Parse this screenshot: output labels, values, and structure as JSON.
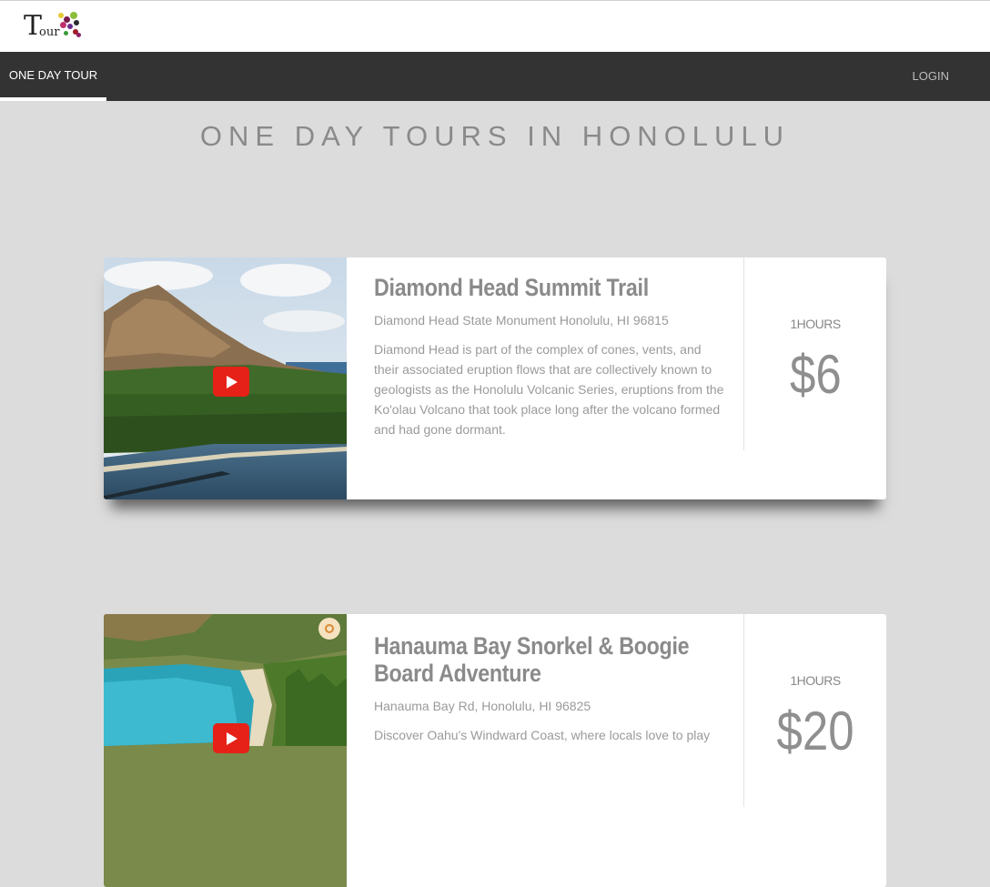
{
  "logo": {
    "big_letter": "T",
    "small_text": "our"
  },
  "nav": {
    "active_tab": "ONE DAY TOUR",
    "login": "LOGIN"
  },
  "page": {
    "title": "ONE DAY TOURS IN HONOLULU"
  },
  "tours": [
    {
      "title": "Diamond Head Summit Trail",
      "address": "Diamond Head State Monument Honolulu, HI 96815",
      "description": "Diamond Head is part of the complex of cones, vents, and their associated eruption flows that are collectively known to geologists as the Honolulu Volcanic Series, eruptions from the Ko'olau Volcano that took place long after the volcano formed and had gone dormant.",
      "duration": "1HOURS",
      "price": "$6"
    },
    {
      "title": "Hanauma Bay Snorkel & Boogie Board Adventure",
      "address": "Hanauma Bay Rd, Honolulu, HI 96825",
      "description": "Discover Oahu's Windward Coast, where locals love to play",
      "duration": "1HOURS",
      "price": "$20"
    }
  ],
  "icons": {
    "play": "youtube-play-icon",
    "badge": "flower-badge-icon"
  },
  "colors": {
    "navbar": "#333333",
    "background": "#dcdcdc",
    "play": "#e62117"
  }
}
